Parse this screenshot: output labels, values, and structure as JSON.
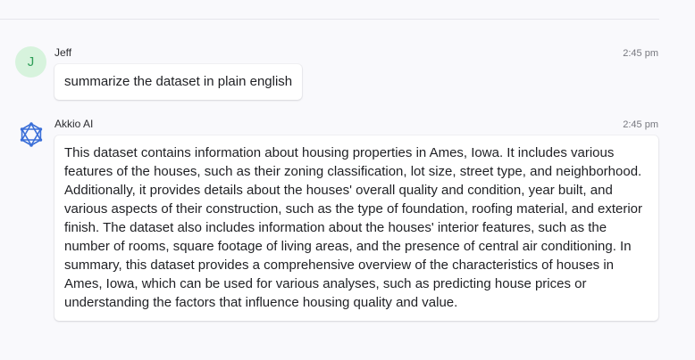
{
  "messages": [
    {
      "sender": "Jeff",
      "avatar_initial": "J",
      "time": "2:45 pm",
      "text": "summarize the dataset in plain english"
    },
    {
      "sender": "Akkio AI",
      "avatar_icon": "akkio-logo-icon",
      "time": "2:45 pm",
      "text": "This dataset contains information about housing properties in Ames, Iowa. It includes various features of the houses, such as their zoning classification, lot size, street type, and neighborhood. Additionally, it provides details about the houses' overall quality and condition, year built, and various aspects of their construction, such as the type of foundation, roofing material, and exterior finish. The dataset also includes information about the houses' interior features, such as the number of rooms, square footage of living areas, and the presence of central air conditioning. In summary, this dataset provides a comprehensive overview of the characteristics of houses in Ames, Iowa, which can be used for various analyses, such as predicting house prices or understanding the factors that influence housing quality and value."
    }
  ],
  "colors": {
    "background": "#f9f9fc",
    "user_avatar_bg": "#d7f3dd",
    "user_avatar_fg": "#2f9e58",
    "ai_icon": "#3b6fd8"
  }
}
